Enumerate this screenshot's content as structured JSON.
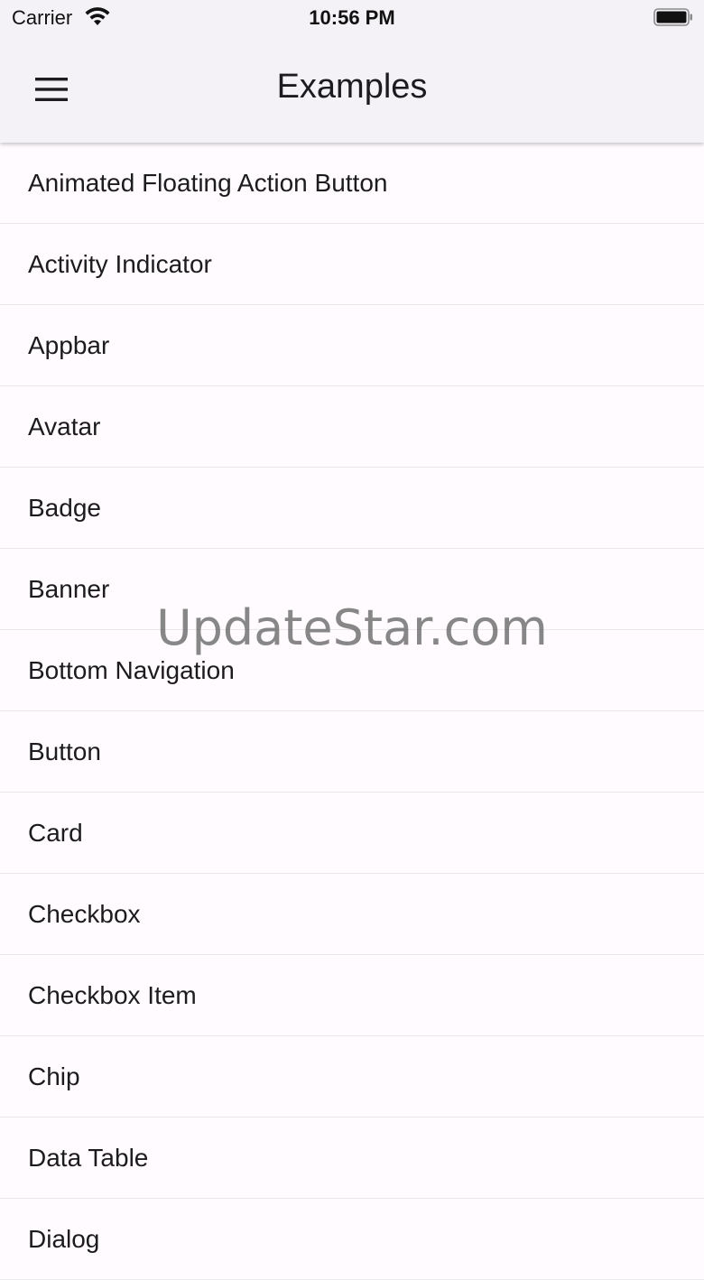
{
  "status_bar": {
    "carrier": "Carrier",
    "time": "10:56 PM",
    "wifi_icon": "wifi-icon",
    "battery_icon": "battery-icon"
  },
  "appbar": {
    "title": "Examples",
    "menu_icon": "hamburger-menu-icon",
    "background": "#f4f2f7"
  },
  "list": {
    "items": [
      {
        "label": "Animated Floating Action Button"
      },
      {
        "label": "Activity Indicator"
      },
      {
        "label": "Appbar"
      },
      {
        "label": "Avatar"
      },
      {
        "label": "Badge"
      },
      {
        "label": "Banner"
      },
      {
        "label": "Bottom Navigation"
      },
      {
        "label": "Button"
      },
      {
        "label": "Card"
      },
      {
        "label": "Checkbox"
      },
      {
        "label": "Checkbox Item"
      },
      {
        "label": "Chip"
      },
      {
        "label": "Data Table"
      },
      {
        "label": "Dialog"
      }
    ]
  },
  "watermark": "UpdateStar.com"
}
